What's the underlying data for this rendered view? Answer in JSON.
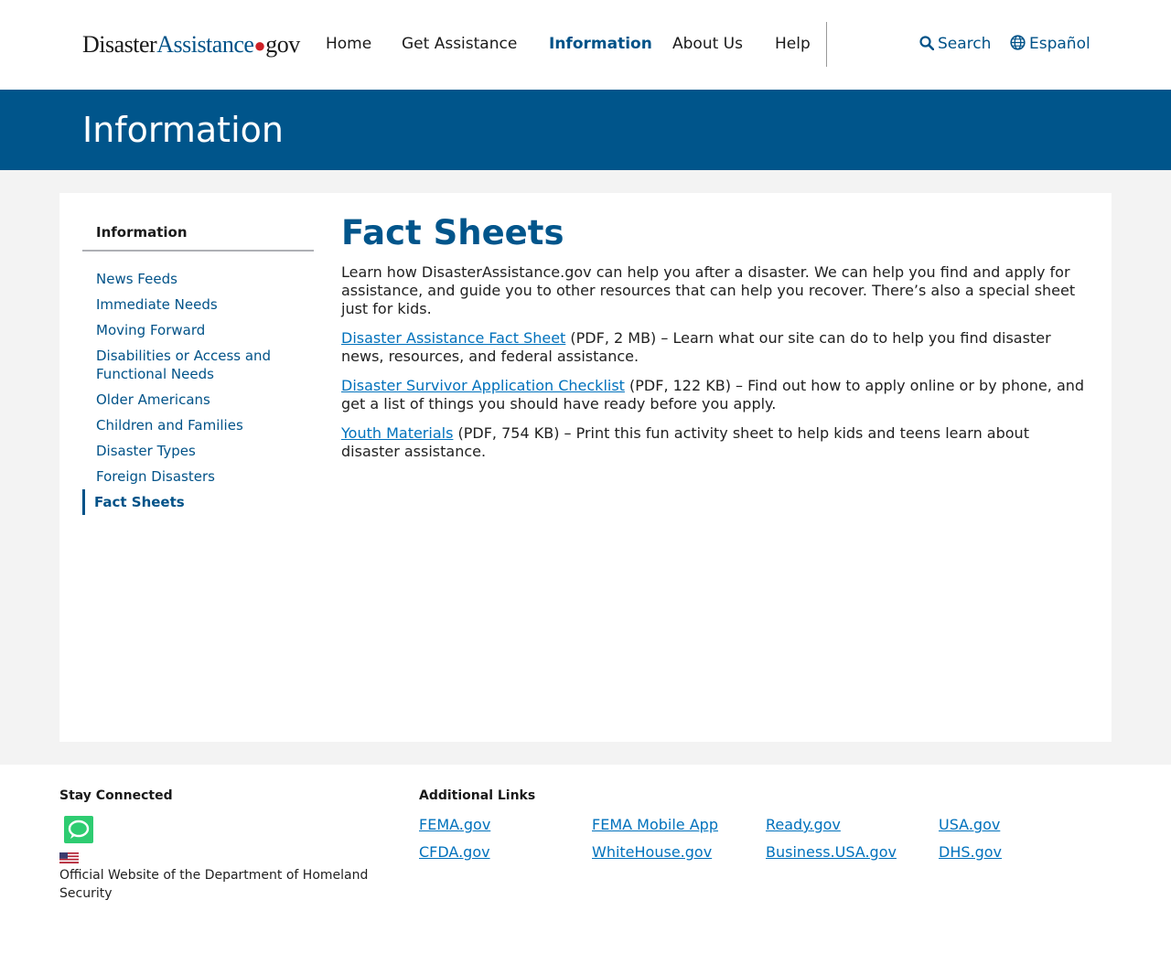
{
  "header": {
    "logo": {
      "part1": "Disaster",
      "part2": "Assistance",
      "part3": "gov"
    },
    "nav": [
      {
        "label": "Home"
      },
      {
        "label": "Get Assistance"
      },
      {
        "label": "Information",
        "active": true
      },
      {
        "label": "About Us"
      },
      {
        "label": "Help"
      }
    ],
    "search_label": "Search",
    "language_label": "Español"
  },
  "banner": {
    "title": "Information"
  },
  "sidebar": {
    "heading": "Information",
    "items": [
      {
        "label": "News Feeds"
      },
      {
        "label": "Immediate Needs"
      },
      {
        "label": "Moving Forward"
      },
      {
        "label": "Disabilities or Access and Functional Needs"
      },
      {
        "label": "Older Americans"
      },
      {
        "label": "Children and Families"
      },
      {
        "label": "Disaster Types"
      },
      {
        "label": "Foreign Disasters"
      },
      {
        "label": "Fact Sheets",
        "active": true
      }
    ]
  },
  "main": {
    "title": "Fact Sheets",
    "intro": "Learn how DisasterAssistance.gov can help you after a disaster. We can help you find and apply for assistance, and guide you to other resources that can help you recover. There’s also a special sheet just for kids.",
    "sheets": [
      {
        "link": "Disaster Assistance Fact Sheet",
        "meta": " (PDF, 2 MB)",
        "desc": " – Learn what our site can do to help you find disaster news, resources, and federal assistance."
      },
      {
        "link": "Disaster Survivor Application Checklist",
        "meta": " (PDF, 122 KB)",
        "desc": " – Find out how to apply online or by phone, and get a list of things you should have ready before you apply."
      },
      {
        "link": "Youth Materials",
        "meta": " (PDF, 754 KB)",
        "desc": " – Print this fun activity sheet to help kids and teens learn about disaster assistance."
      }
    ]
  },
  "footer": {
    "stay_connected": "Stay Connected",
    "official": "Official Website of the Department of Homeland Security",
    "additional_links_heading": "Additional Links",
    "links": [
      {
        "label": "FEMA.gov"
      },
      {
        "label": "FEMA Mobile App"
      },
      {
        "label": "Ready.gov"
      },
      {
        "label": "USA.gov"
      },
      {
        "label": "CFDA.gov"
      },
      {
        "label": "WhiteHouse.gov"
      },
      {
        "label": "Business.USA.gov"
      },
      {
        "label": "DHS.gov"
      }
    ]
  },
  "colors": {
    "brand_blue": "#00558b",
    "link_blue": "#0071bc",
    "logo_dot_red": "#cd2026",
    "chat_green": "#2ecc71"
  },
  "icons": {
    "search": "magnifier-icon",
    "language": "globe-icon",
    "chat": "chat-bubble-icon",
    "flag": "us-flag-icon"
  }
}
